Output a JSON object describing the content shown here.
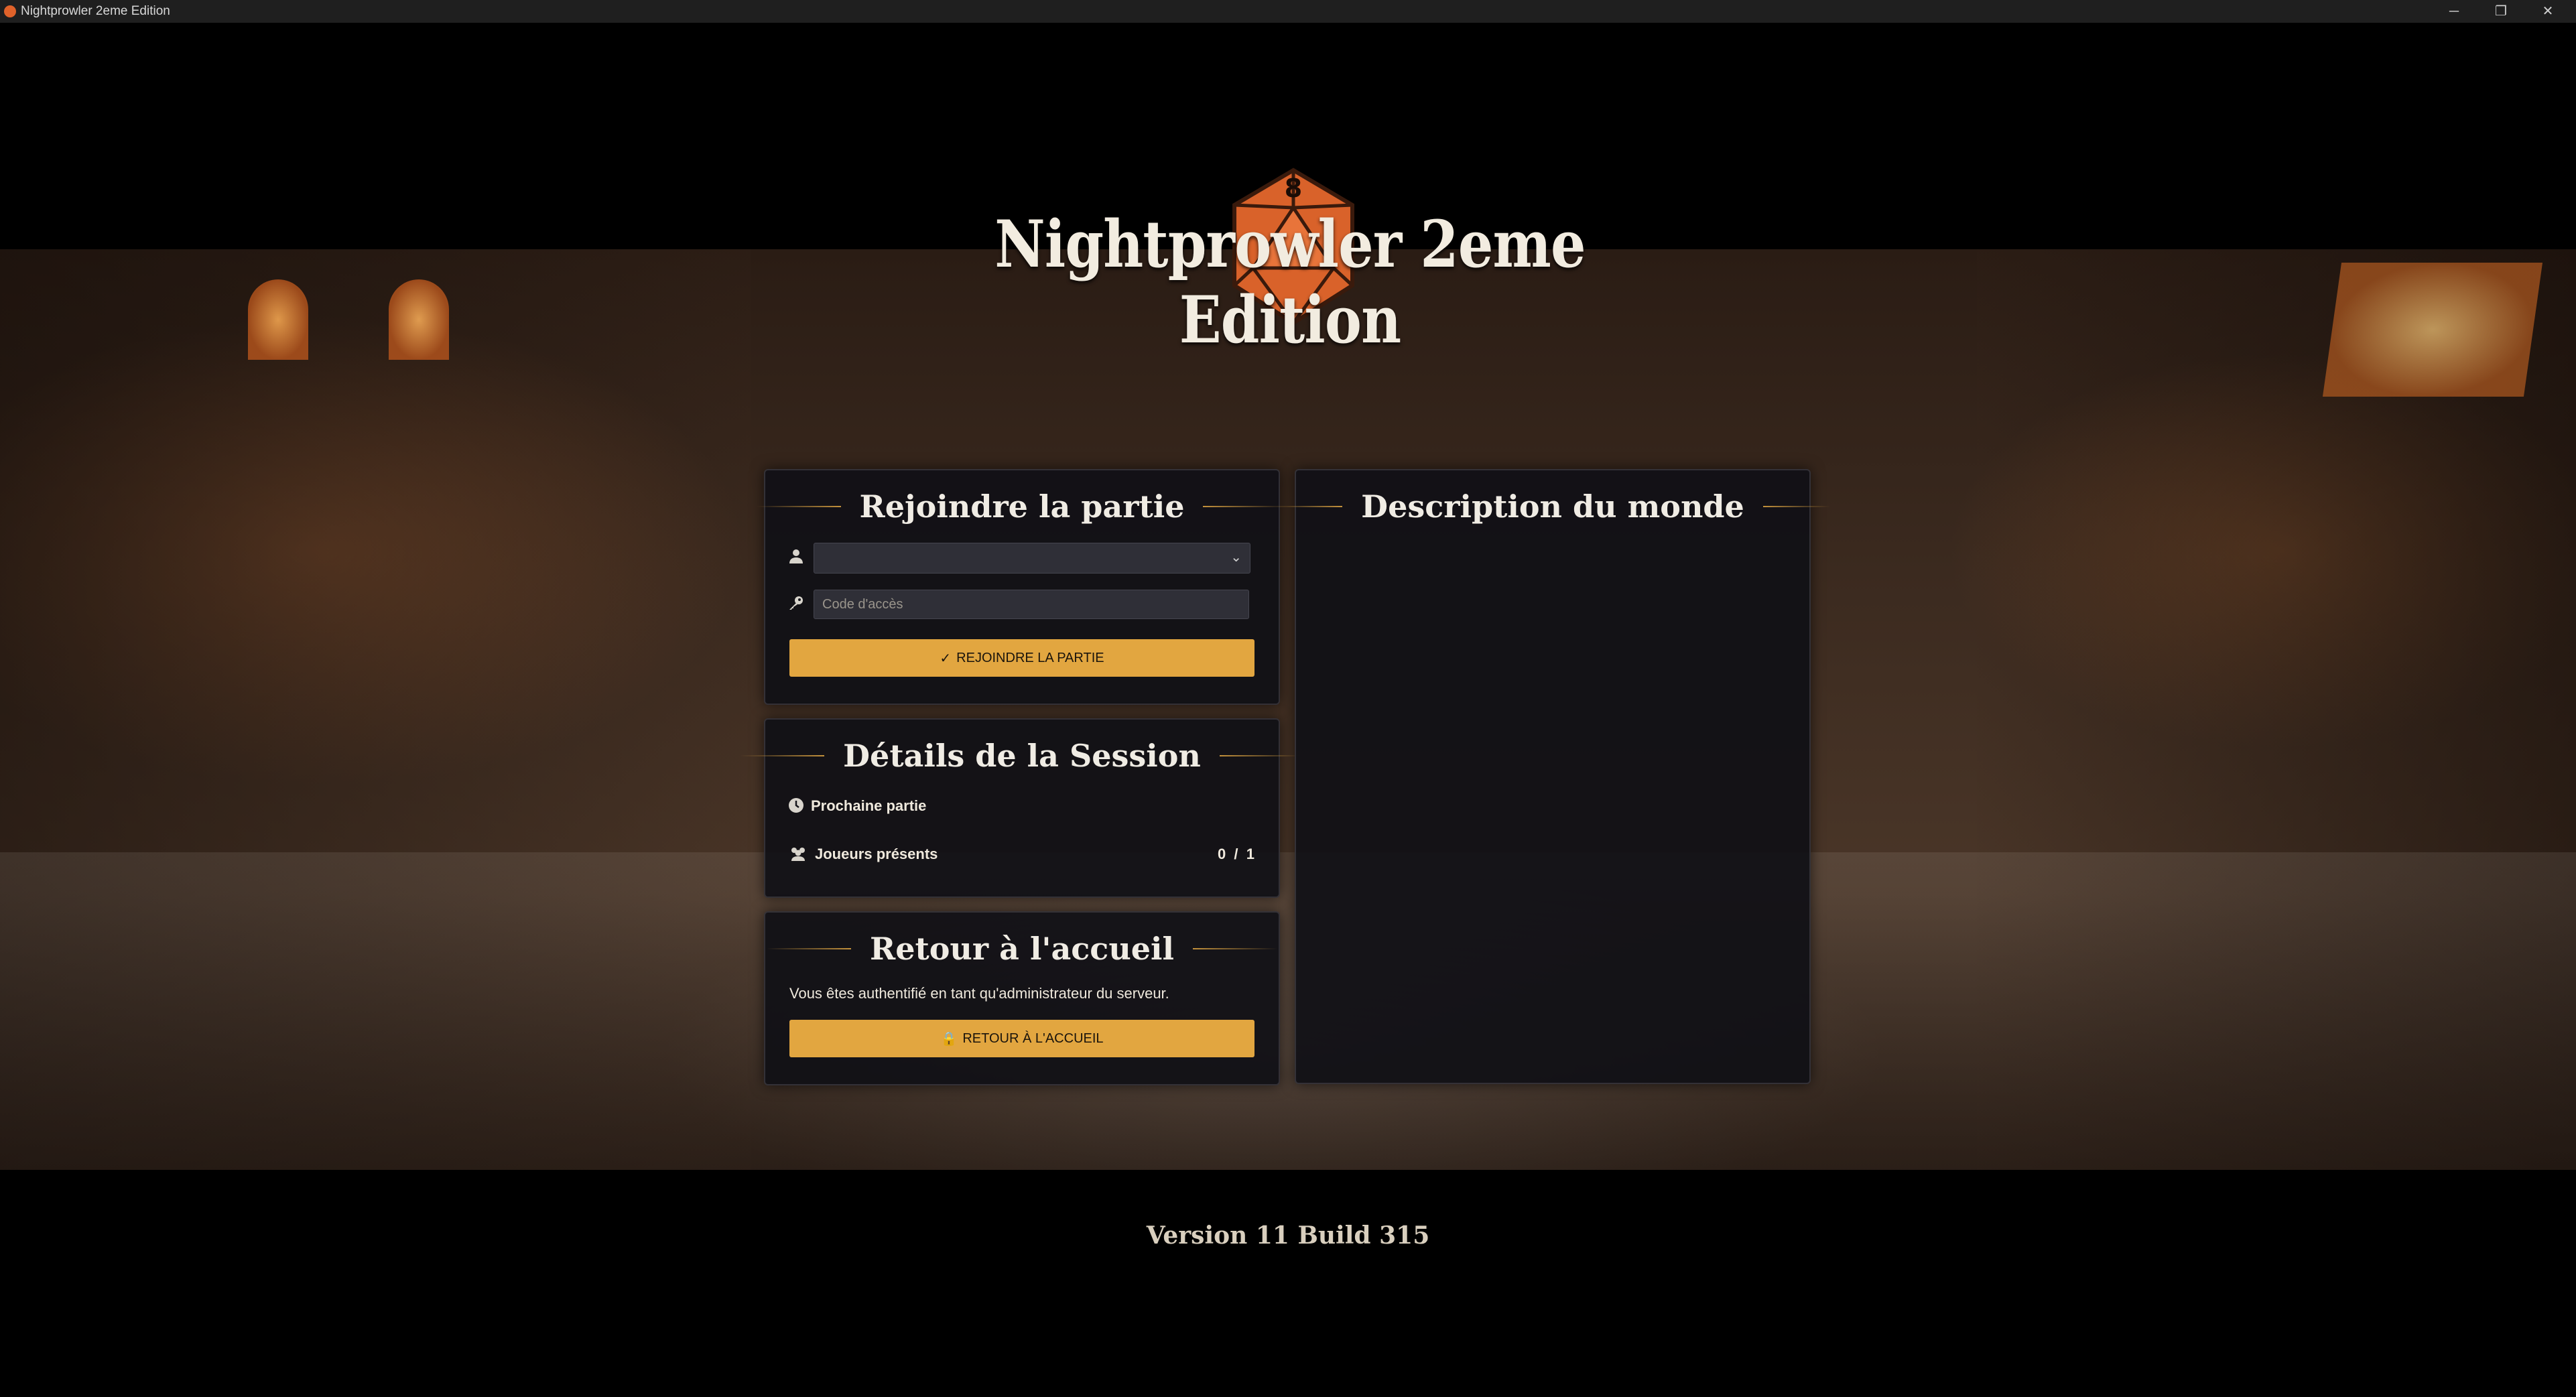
{
  "window": {
    "title": "Nightprowler 2eme Edition",
    "controls": {
      "minimize": "─",
      "maximize": "❐",
      "close": "✕"
    }
  },
  "logo": {
    "text": "Nightprowler 2eme Edition",
    "dice_number": "8"
  },
  "join_panel": {
    "title": "Rejoindre la partie",
    "user_select": {
      "value": ""
    },
    "access_code": {
      "placeholder": "Code d'accès",
      "value": ""
    },
    "join_button": "REJOINDRE LA PARTIE"
  },
  "session_panel": {
    "title": "Détails de la Session",
    "next_game_label": "Prochaine partie",
    "players_label": "Joueurs présents",
    "players_count": "0  /  1"
  },
  "return_panel": {
    "title": "Retour à l'accueil",
    "message": "Vous êtes authentifié en tant qu'administrateur du serveur.",
    "return_button": "RETOUR À L'ACCUEIL"
  },
  "world_panel": {
    "title": "Description du monde"
  },
  "footer": {
    "version": "Version 11 Build 315"
  },
  "colors": {
    "accent_gold": "#e2a640",
    "panel_bg": "#101016",
    "title_rule": "#c4923c"
  }
}
